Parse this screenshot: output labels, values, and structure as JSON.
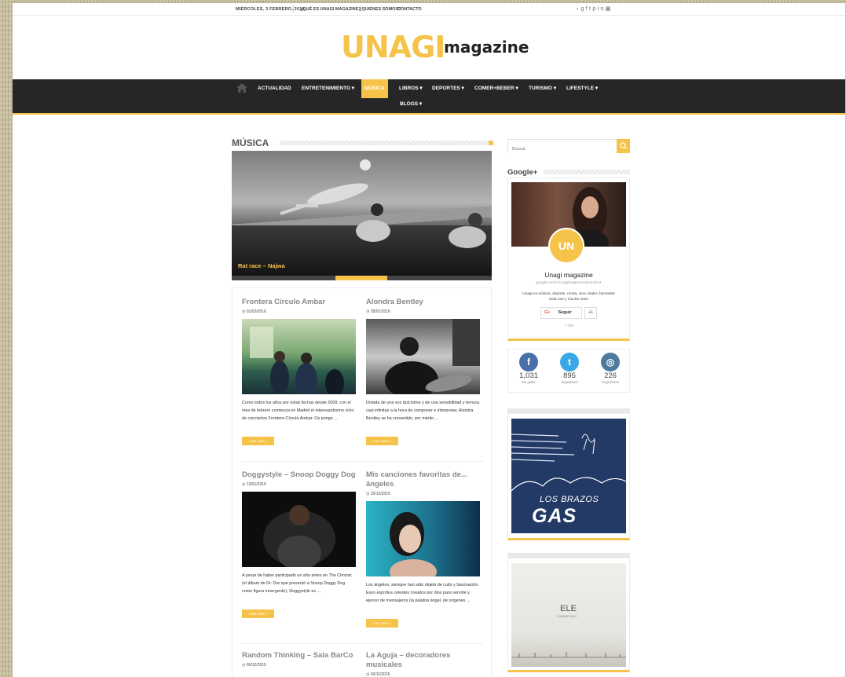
{
  "topbar": {
    "date": "MIÉRCOLES, 3 FEBRERO, 2016",
    "links": [
      "¿QUÉ ES UNAGI MAGAZINE?",
      "¿QUIÉNES SOMOS?",
      "CONTACTO"
    ],
    "social_icons": [
      "rss-icon",
      "google-plus-icon",
      "facebook-icon",
      "twitter-icon",
      "pinterest-icon",
      "linkedin-icon",
      "instagram-icon"
    ]
  },
  "logo": {
    "brand": "UNAGI",
    "suffix": "magazine"
  },
  "nav": {
    "items": [
      "ACTUALIDAD",
      "ENTRETENIMIENTO ▾",
      "MÚSICA",
      "LIBROS ▾",
      "DEPORTES ▾",
      "COMER+BEBER ▾",
      "TURISMO ▾",
      "LIFESTYLE ▾",
      "BLOGS ▾"
    ],
    "active": "MÚSICA",
    "accent": "#f6c34a",
    "bar_color": "#262626"
  },
  "section": {
    "title": "MÚSICA"
  },
  "slider": {
    "caption": "Rat race – Najwa"
  },
  "posts": [
    {
      "title": "Frontera Círculo Ambar",
      "date": "01/02/2016",
      "excerpt": "Como todos los años por estas fechas desde 2009, con el mes de febrero comienza en Madrid el interesantísimo ciclo de conciertos Frontera Círculo Ambar. Os pongo ...",
      "more": "Leer más »"
    },
    {
      "title": "Alondra Bentley",
      "date": "28/01/2016",
      "excerpt": "Dotada de una voz dulcísima y de una sensibilidad y ternura casi infinitas a la hora de componer e interpretar, Alondra Bentley se ha convertido, por mérito ...",
      "more": "Leer más »"
    },
    {
      "title": "Doggystyle – Snoop Doggy Dog",
      "date": "13/01/2016",
      "excerpt": "A pesar de haber participado un año antes en The Chronic (el álbum de Dr. Dre que presentó a Snoop Doggy Dog como figura emergente), Doggystyle es ...",
      "more": "Leer más »"
    },
    {
      "title": "Mis canciones favoritas de... ángeles",
      "date": "15/12/2015",
      "excerpt": "Los ángeles, siempre han sido objeto de culto y fascinación. Esos espíritus celestes creados por dios para servirle y ejercer de mensajeros (la palabra ángel, de orígenes ...",
      "more": "Leer más »"
    },
    {
      "title": "Random Thinking – Sala BarCo",
      "date": "09/12/2015",
      "excerpt": "",
      "more": ""
    },
    {
      "title": "La Aguja – decoradores musicales",
      "date": "30/11/2015",
      "excerpt": "",
      "more": ""
    }
  ],
  "sidebar": {
    "search_placeholder": "Buscar",
    "gplus": {
      "title": "Google+",
      "avatar_text": "UN AGI",
      "name": "Unagi magazine",
      "url": "google.com/+Unagimagazine01112013",
      "desc": "Unagi es música, deporte, moda, cine, teatro, bienestar todo eso y mucho más!",
      "follow_label": "Seguir",
      "g_label": "G+",
      "count": "+1",
      "followers": "+ 739"
    },
    "counters": [
      {
        "icon": "facebook-icon",
        "glyph": "f",
        "number": "1,031",
        "label": "Me gusta",
        "color": "#4a6ea9"
      },
      {
        "icon": "twitter-icon",
        "glyph": "t",
        "number": "895",
        "label": "Seguidores",
        "color": "#3aa8e6"
      },
      {
        "icon": "instagram-icon",
        "glyph": "◎",
        "number": "226",
        "label": "Seguidores",
        "color": "#4d7a9e"
      }
    ],
    "ad1": {
      "line1": "LOS BRAZOS",
      "line2": "GAS"
    },
    "ad2": {
      "line1": "ELE",
      "line2": "SUMMER RAIN"
    }
  }
}
